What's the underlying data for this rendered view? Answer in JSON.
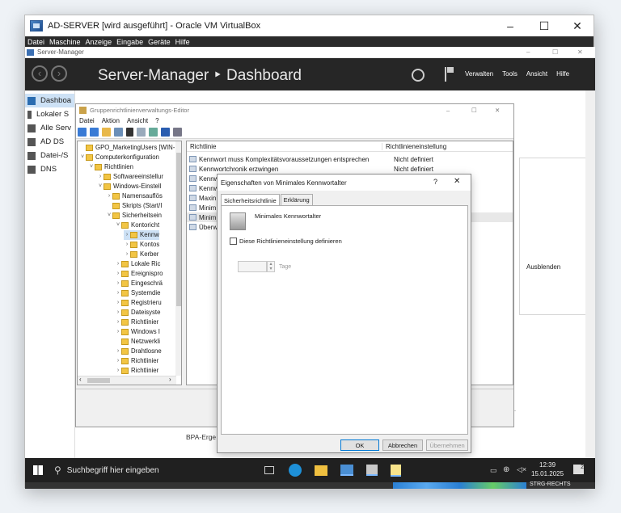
{
  "vbox": {
    "title": "AD-SERVER [wird ausgeführt] - Oracle VM VirtualBox",
    "minimize": "–",
    "maximize": "☐",
    "close": "✕",
    "menu": [
      "Datei",
      "Maschine",
      "Anzeige",
      "Eingabe",
      "Geräte",
      "Hilfe"
    ]
  },
  "servermanager": {
    "title": "Server-Manager",
    "heading": "Server-Manager ‣ Dashboard",
    "actions": [
      "Verwalten",
      "Tools",
      "Ansicht",
      "Hilfe"
    ],
    "nav": [
      "Dashboa",
      "Lokaler S",
      "Alle Serv",
      "AD DS",
      "Datei-/S",
      "DNS"
    ],
    "hide": "Ausblenden",
    "bpa": "BPA-Erge"
  },
  "gpe": {
    "title": "Gruppenrichtlinienverwaltungs-Editor",
    "menu": [
      "Datei",
      "Aktion",
      "Ansicht",
      "?"
    ],
    "tree": [
      {
        "label": "GPO_MarketingUsers [WIN-",
        "lvl": 0,
        "ex": ""
      },
      {
        "label": "Computerkonfiguration",
        "lvl": 0,
        "ex": "˅"
      },
      {
        "label": "Richtlinien",
        "lvl": 1,
        "ex": "˅"
      },
      {
        "label": "Softwareeinstellur",
        "lvl": 2,
        "ex": "›"
      },
      {
        "label": "Windows-Einstell",
        "lvl": 2,
        "ex": "˅"
      },
      {
        "label": "Namensauflös",
        "lvl": 3,
        "ex": "›"
      },
      {
        "label": "Skripts (Start/I",
        "lvl": 3,
        "ex": ""
      },
      {
        "label": "Sicherheitsein",
        "lvl": 3,
        "ex": "˅"
      },
      {
        "label": "Kontoricht",
        "lvl": 4,
        "ex": "˅"
      },
      {
        "label": "Kennw",
        "lvl": 5,
        "ex": "›"
      },
      {
        "label": "Kontos",
        "lvl": 5,
        "ex": "›"
      },
      {
        "label": "Kerber",
        "lvl": 5,
        "ex": "›"
      },
      {
        "label": "Lokale Ric",
        "lvl": 4,
        "ex": "›"
      },
      {
        "label": "Ereignispro",
        "lvl": 4,
        "ex": "›"
      },
      {
        "label": "Eingeschrä",
        "lvl": 4,
        "ex": "›"
      },
      {
        "label": "Systemdie",
        "lvl": 4,
        "ex": "›"
      },
      {
        "label": "Registrieru",
        "lvl": 4,
        "ex": "›"
      },
      {
        "label": "Dateisyste",
        "lvl": 4,
        "ex": "›"
      },
      {
        "label": "Richtlinier",
        "lvl": 4,
        "ex": "›"
      },
      {
        "label": "Windows I",
        "lvl": 4,
        "ex": "›"
      },
      {
        "label": "Netzwerkli",
        "lvl": 4,
        "ex": ""
      },
      {
        "label": "Drahtlosne",
        "lvl": 4,
        "ex": "›"
      },
      {
        "label": "Richtlinier",
        "lvl": 4,
        "ex": "›"
      },
      {
        "label": "Richtlinier",
        "lvl": 4,
        "ex": "›"
      }
    ],
    "col_policy": "Richtlinie",
    "col_setting": "Richtlinieneinstellung",
    "rows": [
      {
        "policy": "Kennwort muss Komplexitätsvoraussetzungen entsprechen",
        "setting": "Nicht definiert"
      },
      {
        "policy": "Kennwortchronik erzwingen",
        "setting": "Nicht definiert"
      },
      {
        "policy": "Kennw",
        "setting": ""
      },
      {
        "policy": "Kennw",
        "setting": ""
      },
      {
        "policy": "Maxin",
        "setting": ""
      },
      {
        "policy": "Minim",
        "setting": ""
      },
      {
        "policy": "Minim",
        "setting": ""
      },
      {
        "policy": "Überw",
        "setting": ""
      }
    ]
  },
  "dialog": {
    "title": "Eigenschaften von Minimales Kennwortalter",
    "help": "?",
    "close": "✕",
    "tabs": [
      "Sicherheitsrichtlinie",
      "Erklärung"
    ],
    "policy_name": "Minimales Kennwortalter",
    "checkbox_label": "Diese Richtlinieneinstellung definieren",
    "days_value": "",
    "days_unit": "Tage",
    "ok": "OK",
    "cancel": "Abbrechen",
    "apply": "Übernehmen"
  },
  "taskbar": {
    "search_placeholder": "Suchbegriff hier eingeben",
    "time": "12:39",
    "date": "15.01.2025",
    "badge": "2",
    "hostkey": "STRG-RECHTS"
  }
}
